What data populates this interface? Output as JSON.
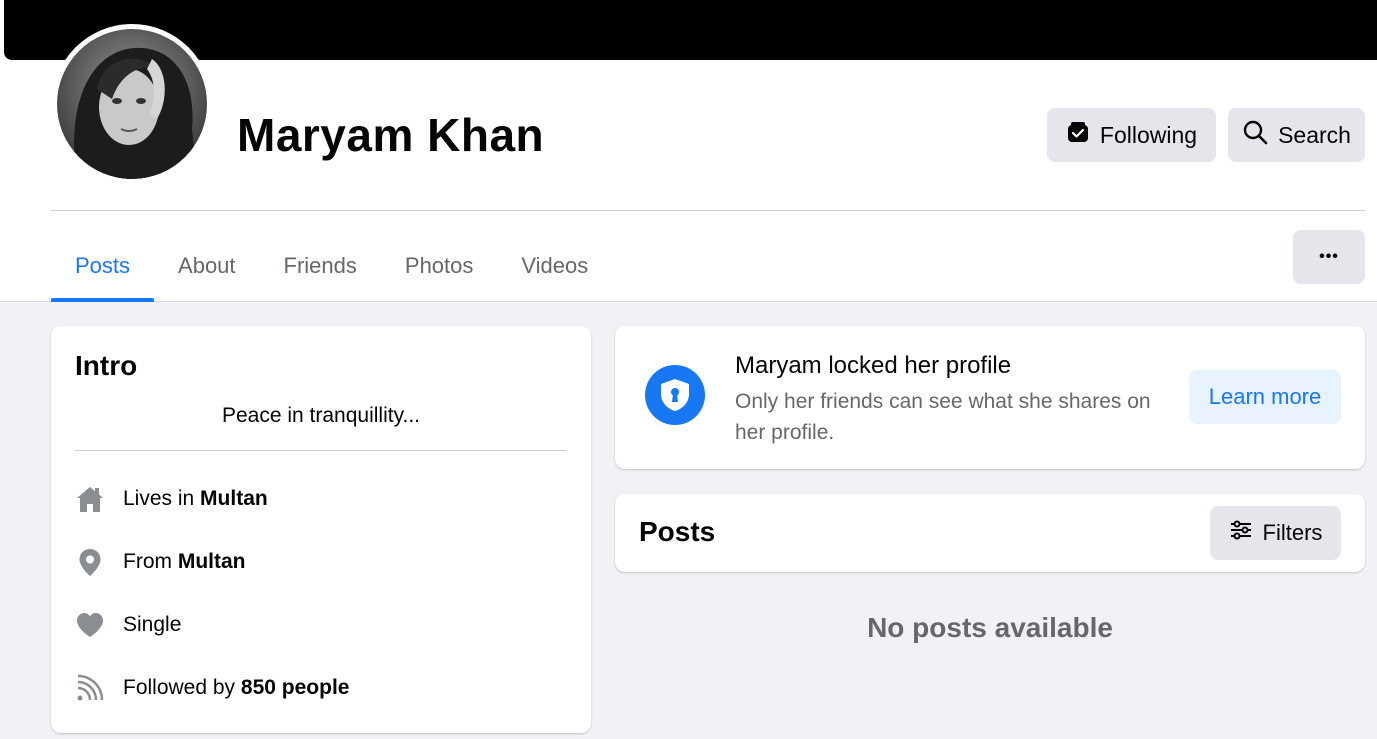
{
  "profile": {
    "name": "Maryam Khan",
    "following_label": "Following",
    "search_label": "Search",
    "more_label": "•••"
  },
  "tabs": [
    {
      "label": "Posts",
      "active": true
    },
    {
      "label": "About",
      "active": false
    },
    {
      "label": "Friends",
      "active": false
    },
    {
      "label": "Photos",
      "active": false
    },
    {
      "label": "Videos",
      "active": false
    }
  ],
  "intro": {
    "title": "Intro",
    "bio": "Peace in tranquillity...",
    "items": [
      {
        "icon": "home-icon",
        "prefix": "Lives in",
        "value": "Multan"
      },
      {
        "icon": "location-pin-icon",
        "prefix": "From",
        "value": "Multan"
      },
      {
        "icon": "heart-icon",
        "prefix": "Single",
        "value": ""
      },
      {
        "icon": "rss-feed-icon",
        "prefix": "Followed by",
        "value": "850 people"
      }
    ]
  },
  "locked": {
    "title": "Maryam locked her profile",
    "description": "Only her friends can see what she shares on her profile.",
    "learn_more": "Learn more"
  },
  "posts": {
    "title": "Posts",
    "filters_label": "Filters",
    "empty_text": "No posts available"
  },
  "colors": {
    "accent": "#1877f2",
    "page_bg": "#f0f2f5",
    "button_gray": "#e4e6eb",
    "secondary_text": "#65676b",
    "icon_gray": "#8a8d91"
  }
}
